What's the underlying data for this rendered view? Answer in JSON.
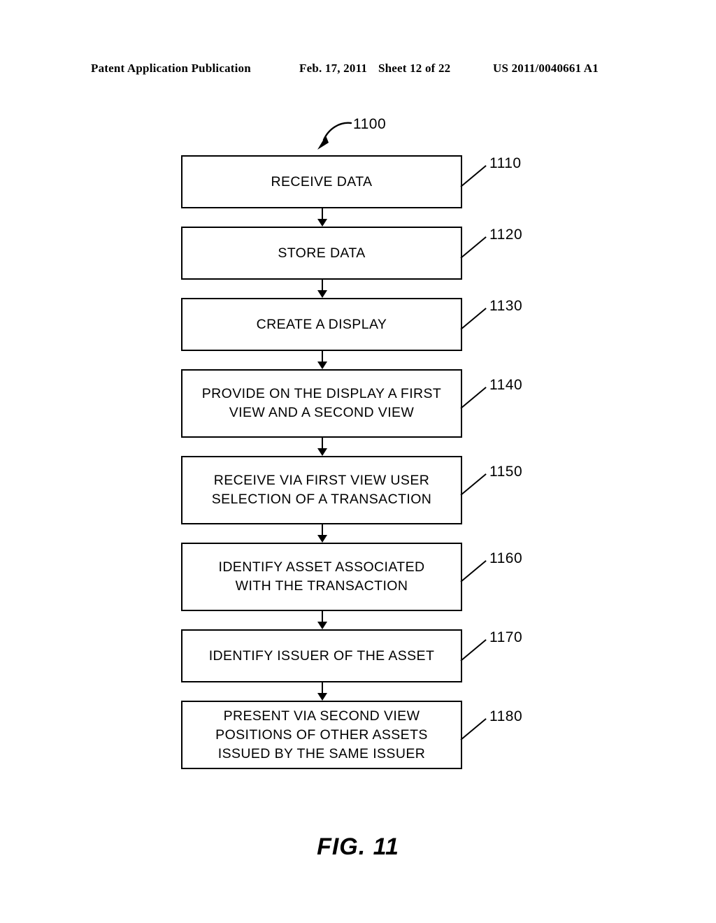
{
  "header": {
    "publication": "Patent Application Publication",
    "date": "Feb. 17, 2011",
    "sheet": "Sheet 12 of 22",
    "patent_number": "US 2011/0040661 A1"
  },
  "figure": {
    "caption": "FIG. 11",
    "diagram_reference": "1100"
  },
  "flowchart": {
    "type": "flowchart",
    "orientation": "vertical",
    "steps": [
      {
        "ref": "1110",
        "text": "RECEIVE DATA",
        "lines": 1
      },
      {
        "ref": "1120",
        "text": "STORE DATA",
        "lines": 1
      },
      {
        "ref": "1130",
        "text": "CREATE A DISPLAY",
        "lines": 1
      },
      {
        "ref": "1140",
        "text": "PROVIDE ON THE DISPLAY A FIRST\nVIEW AND A SECOND VIEW",
        "lines": 2
      },
      {
        "ref": "1150",
        "text": "RECEIVE VIA FIRST VIEW USER\nSELECTION OF A TRANSACTION",
        "lines": 2
      },
      {
        "ref": "1160",
        "text": "IDENTIFY ASSET ASSOCIATED\nWITH THE TRANSACTION",
        "lines": 2
      },
      {
        "ref": "1170",
        "text": "IDENTIFY ISSUER OF THE ASSET",
        "lines": 1
      },
      {
        "ref": "1180",
        "text": "PRESENT VIA SECOND VIEW\nPOSITIONS OF OTHER ASSETS\nISSUED BY THE SAME ISSUER",
        "lines": 3
      }
    ]
  },
  "colors": {
    "ink": "#000000",
    "paper": "#ffffff"
  }
}
